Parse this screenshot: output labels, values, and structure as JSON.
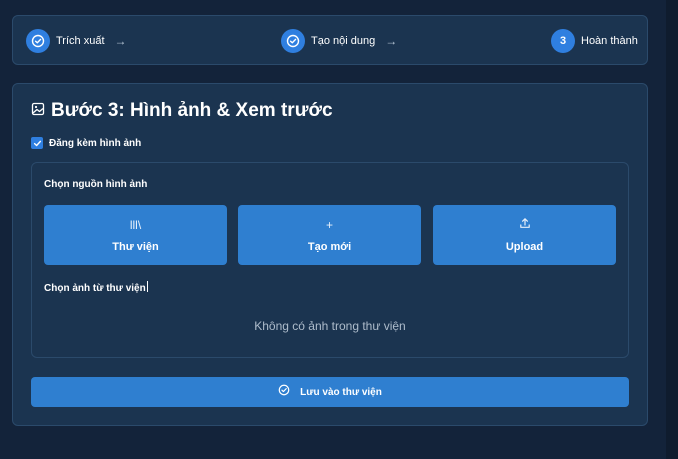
{
  "stepper": {
    "steps": [
      {
        "label": "Trích xuất",
        "icon": "check-circle-icon",
        "arrow": "→"
      },
      {
        "label": "Tạo nội dung",
        "icon": "check-circle-icon",
        "arrow": "→"
      },
      {
        "label": "Hoàn thành",
        "number": "3"
      }
    ]
  },
  "card": {
    "title": "Bước 3: Hình ảnh & Xem trước",
    "title_icon": "image-icon",
    "attach_checkbox": {
      "label": "Đăng kèm hình ảnh",
      "checked": true
    },
    "source": {
      "heading": "Chọn nguồn hình ảnh",
      "buttons": [
        {
          "label": "Thư viện",
          "icon": "library-icon",
          "glyph": "lll\\"
        },
        {
          "label": "Tạo mới",
          "icon": "plus-icon",
          "glyph": "+"
        },
        {
          "label": "Upload",
          "icon": "upload-icon"
        }
      ]
    },
    "library": {
      "heading": "Chọn ảnh từ thư viện",
      "empty_text": "Không có ảnh trong thư viện"
    },
    "save_button": {
      "label": "Lưu vào thư viện",
      "icon": "check-circle-icon"
    }
  },
  "colors": {
    "background": "#13233a",
    "card": "#1b3450",
    "border": "#2b4a6b",
    "accent": "#2f7fd0"
  }
}
